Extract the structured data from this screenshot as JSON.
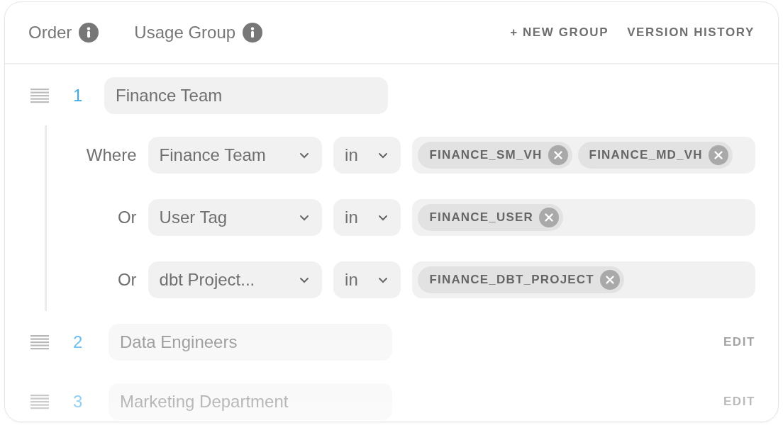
{
  "header": {
    "columns": [
      {
        "label": "Order"
      },
      {
        "label": "Usage Group"
      }
    ],
    "actions": [
      "+ NEW GROUP",
      "VERSION HISTORY"
    ]
  },
  "groups": [
    {
      "order": "1",
      "name": "Finance Team",
      "expanded": true,
      "conditions": [
        {
          "connector": "Where",
          "attribute": "Finance Team",
          "operator": "in",
          "values": [
            "FINANCE_SM_VH",
            "FINANCE_MD_VH"
          ]
        },
        {
          "connector": "Or",
          "attribute": "User Tag",
          "operator": "in",
          "values": [
            "FINANCE_USER"
          ]
        },
        {
          "connector": "Or",
          "attribute": "dbt Project...",
          "operator": "in",
          "values": [
            "FINANCE_DBT_PROJECT"
          ]
        }
      ]
    },
    {
      "order": "2",
      "name": "Data Engineers",
      "expanded": false,
      "action": "EDIT"
    },
    {
      "order": "3",
      "name": "Marketing Department",
      "expanded": false,
      "action": "EDIT"
    }
  ]
}
